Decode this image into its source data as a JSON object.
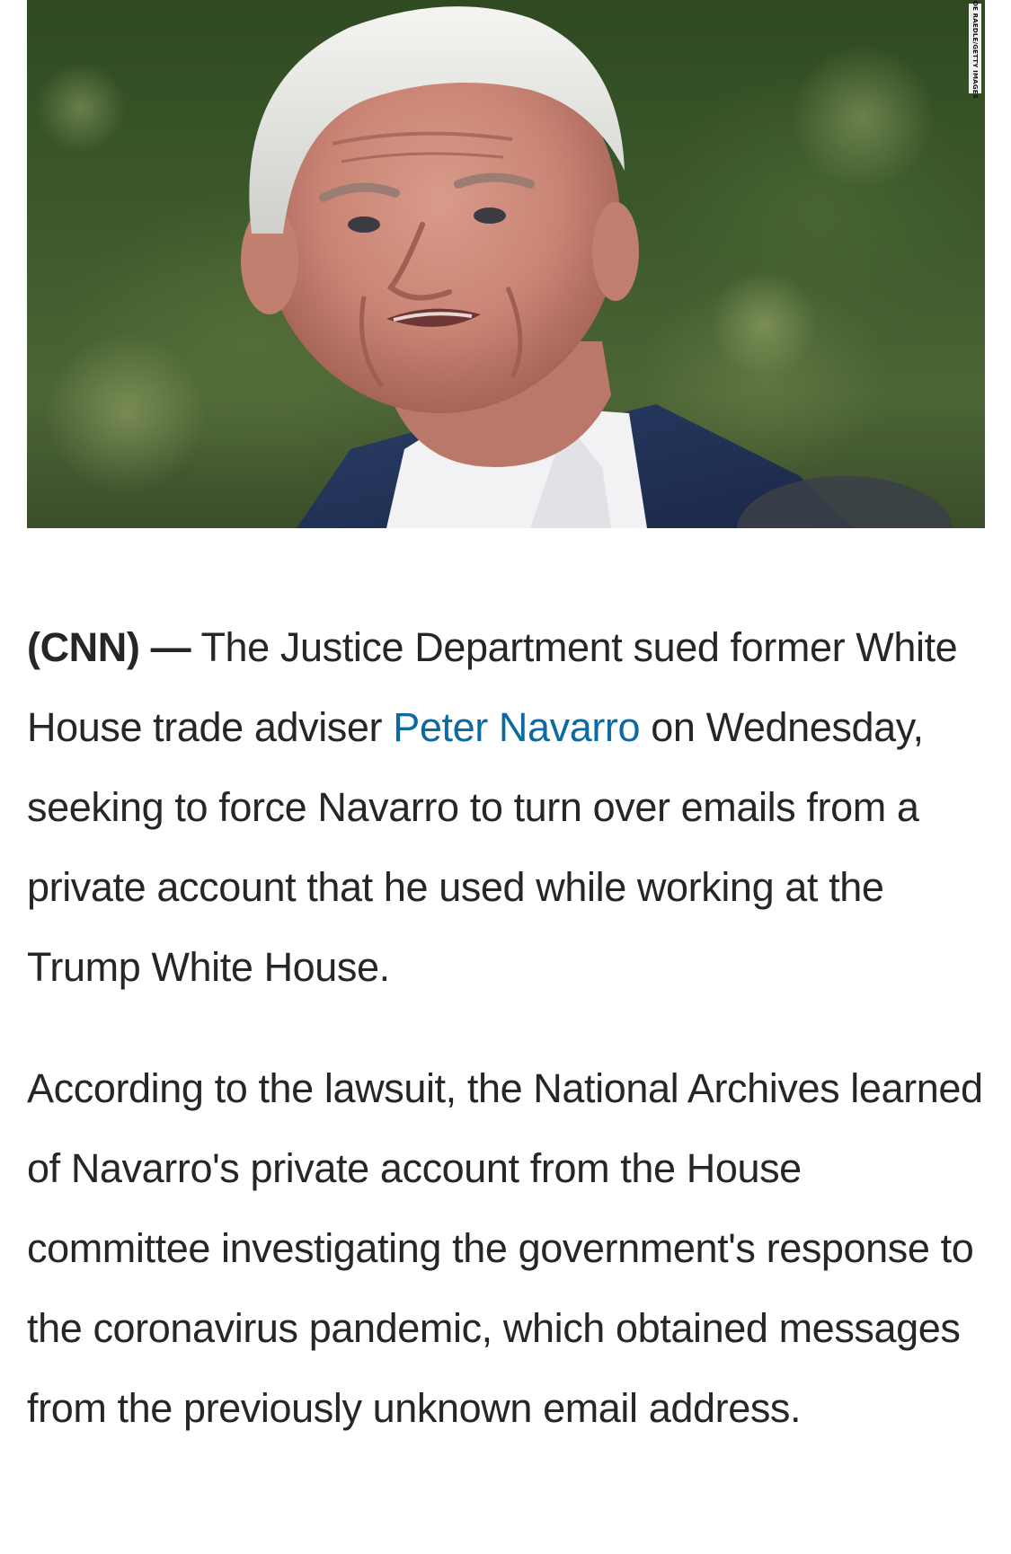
{
  "photo": {
    "alt": "Peter Navarro",
    "credit": "JOE RAEDLE/GETTY IMAGES"
  },
  "article": {
    "paragraph1": {
      "dateline": "(CNN) —",
      "text_before_link": " The Justice Department sued former White House trade adviser ",
      "link_text": "Peter Navarro",
      "text_after_link": " on Wednesday, seeking to force Navarro to turn over emails from a private account that he used while working at the Trump White House."
    },
    "paragraph2": {
      "text": "According to the lawsuit, the National Archives learned of Navarro's private account from the House committee investigating the government's response to the coronavirus pandemic, which obtained messages from the previously unknown email address."
    }
  },
  "colors": {
    "text": "#262626",
    "link": "#0c6aa1",
    "background": "#ffffff"
  }
}
